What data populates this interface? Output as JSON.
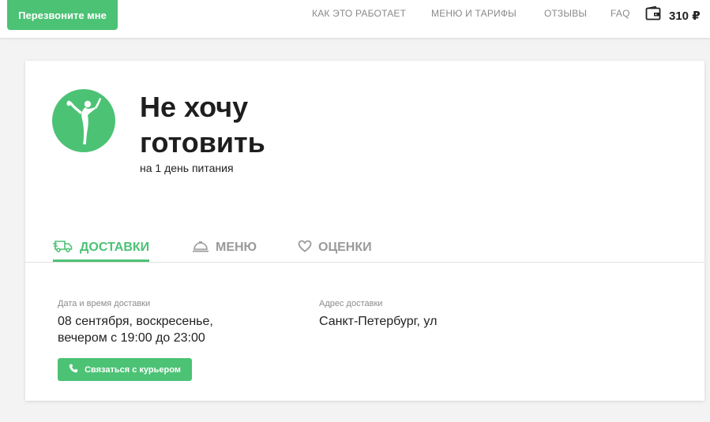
{
  "header": {
    "callback_label": "Перезвоните мне",
    "nav": [
      "КАК ЭТО РАБОТАЕТ",
      "МЕНЮ И ТАРИФЫ",
      "ОТЗЫВЫ",
      "FAQ"
    ],
    "wallet_amount": "310 ₽",
    "wallet_icon": "wallet-icon"
  },
  "plan": {
    "title_line1": "Не хочу",
    "title_line2": "готовить",
    "subtitle": "на 1 день питания",
    "icon": "yoga-pose-icon",
    "accent_color": "#4cc275"
  },
  "tabs": [
    {
      "label": "ДОСТАВКИ",
      "icon": "delivery-truck-icon",
      "active": true
    },
    {
      "label": "МЕНЮ",
      "icon": "food-cloche-icon",
      "active": false
    },
    {
      "label": "ОЦЕНКИ",
      "icon": "heart-icon",
      "active": false
    }
  ],
  "delivery": {
    "datetime_label": "Дата и время доставки",
    "datetime_line1": "08 сентября, воскресенье,",
    "datetime_line2": "вечером с 19:00 до 23:00",
    "address_label": "Адрес доставки",
    "address_value": "Санкт-Петербург, ул",
    "courier_button": "Связаться с курьером",
    "courier_icon": "phone-icon"
  }
}
